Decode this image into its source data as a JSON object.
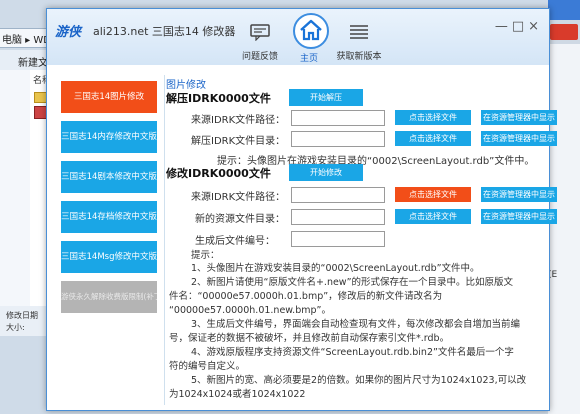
{
  "background": {
    "address_text": "电脑 ▸ WD",
    "toolbar_label": "新建文",
    "files_header": "名称",
    "status_line1": "修改日期",
    "status_line2": "大小:",
    "side_label": "(E"
  },
  "app": {
    "logo": "游侠",
    "title": "ali213.net 三国志14 修改器",
    "nav": [
      {
        "label": "问题反馈",
        "icon": "feedback-icon"
      },
      {
        "label": "主页",
        "icon": "home-icon"
      },
      {
        "label": "获取新版本",
        "icon": "list-icon"
      }
    ],
    "window_controls": "—□×"
  },
  "menu": [
    {
      "label": "三国志14图片修改",
      "active": true
    },
    {
      "label": "三国志14内存修改中文版",
      "active": false
    },
    {
      "label": "三国志14剧本修改中文版",
      "active": false
    },
    {
      "label": "三国志14存档修改中文版",
      "active": false
    },
    {
      "label": "三国志14Msg修改中文版",
      "active": false
    },
    {
      "label": "游侠永久解除收费版限制(补丁)",
      "active": false,
      "disabled": true
    }
  ],
  "content": {
    "section_title": "图片修改",
    "unpack": {
      "heading": "解压IDRK0000文件",
      "start_button": "开始解压",
      "src_label": "来源IDRK文件路径：",
      "dir_label": "解压IDRK文件目录：",
      "choose_button": "点击选择文件",
      "explorer_button": "在资源管理器中显示",
      "hint": "提示：头像图片在游戏安装目录的“0002\\ScreenLayout.rdb”文件中。"
    },
    "modify": {
      "heading": "修改IDRK0000文件",
      "start_button": "开始修改",
      "src_label": "来源IDRK文件路径：",
      "new_dir_label": "新的资源文件目录：",
      "gen_num_label": "生成后文件编号：",
      "choose_button": "点击选择文件",
      "explorer_button": "在资源管理器中显示"
    },
    "notes_title": "提示：",
    "notes": [
      "1、头像图片在游戏安装目录的“0002\\ScreenLayout.rdb”文件中。",
      "2、新图片请使用“原版文件名+.new”的形式保存在一个目录中。比如原版文",
      "件名：“00000e57.0000h.01.bmp”，修改后的新文件请改名为",
      "“00000e57.0000h.01.new.bmp”。",
      "3、生成后文件编号，界面端会自动检查现有文件，每次修改都会自增加当前编",
      "号，保证老的数据不被破坏，并且修改前自动保存索引文件*.rdb。",
      "4、游戏原版程序支持资源文件“ScreenLayout.rdb.bin2”文件名最后一个字",
      "符的编号自定义。",
      "5、新图片的宽、高必须要是2的倍数。如果你的图片尺寸为1024x1023,可以改",
      "为1024x1024或者1024x1022"
    ]
  }
}
